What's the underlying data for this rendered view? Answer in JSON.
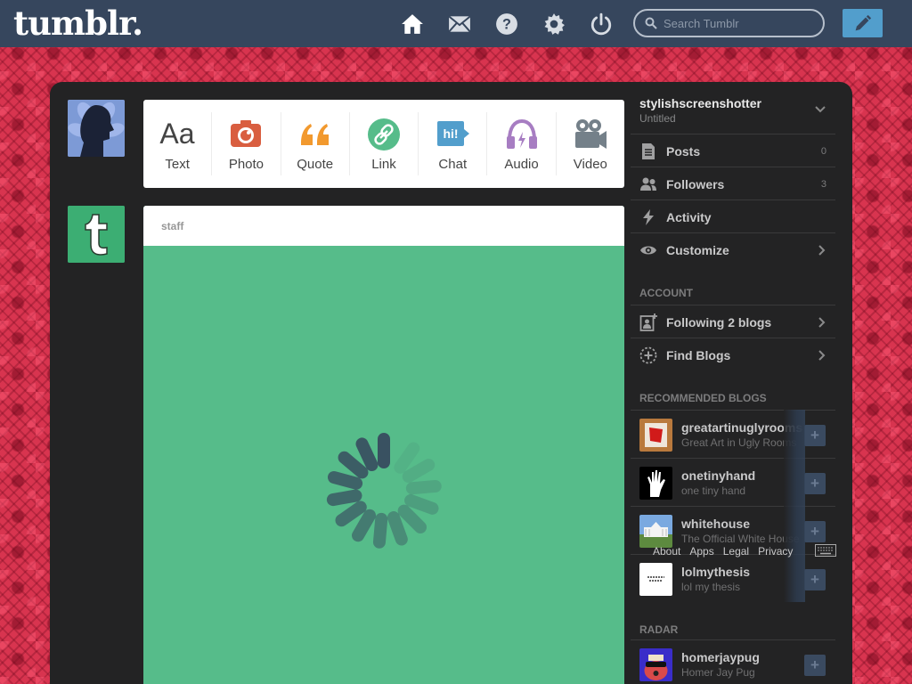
{
  "header": {
    "logo": "tumblr.",
    "search": {
      "placeholder": "Search Tumblr"
    },
    "nav_icons": [
      "home-icon",
      "mail-icon",
      "help-icon",
      "gear-icon",
      "power-icon"
    ],
    "compose_icon": "pencil-icon"
  },
  "post_types": [
    {
      "label": "Text",
      "glyph": "Aa",
      "color": "#444444"
    },
    {
      "label": "Photo",
      "color": "#d95e40"
    },
    {
      "label": "Quote",
      "glyph": "“",
      "color": "#f2992e"
    },
    {
      "label": "Link",
      "color": "#56bc8a"
    },
    {
      "label": "Chat",
      "glyph": "hi!",
      "color": "#529ecc"
    },
    {
      "label": "Audio",
      "color": "#a77dc2"
    },
    {
      "label": "Video",
      "color": "#748089"
    }
  ],
  "post": {
    "blog": "staff",
    "background": "#56bc8a"
  },
  "sidebar": {
    "blog_name": "stylishscreenshotter",
    "blog_title": "Untitled",
    "items": [
      {
        "label": "Posts",
        "count": "0",
        "icon": "posts-icon"
      },
      {
        "label": "Followers",
        "count": "3",
        "icon": "followers-icon"
      },
      {
        "label": "Activity",
        "icon": "lightning-icon"
      },
      {
        "label": "Customize",
        "icon": "eye-icon"
      }
    ],
    "account_heading": "ACCOUNT",
    "account_items": [
      {
        "label": "Following 2 blogs",
        "icon": "following-icon"
      },
      {
        "label": "Find Blogs",
        "icon": "find-blogs-icon"
      }
    ],
    "recommended_heading": "RECOMMENDED BLOGS",
    "recommended": [
      {
        "name": "greatartinuglyrooms",
        "desc": "Great Art in Ugly Rooms"
      },
      {
        "name": "onetinyhand",
        "desc": "one tiny hand"
      },
      {
        "name": "whitehouse",
        "desc": "The Official White House"
      },
      {
        "name": "lolmythesis",
        "desc": "lol my thesis"
      }
    ],
    "radar_heading": "RADAR",
    "radar": [
      {
        "name": "homerjaypug",
        "desc": "Homer Jay Pug"
      }
    ]
  },
  "footer": {
    "links": [
      "About",
      "Apps",
      "Legal",
      "Privacy"
    ]
  }
}
